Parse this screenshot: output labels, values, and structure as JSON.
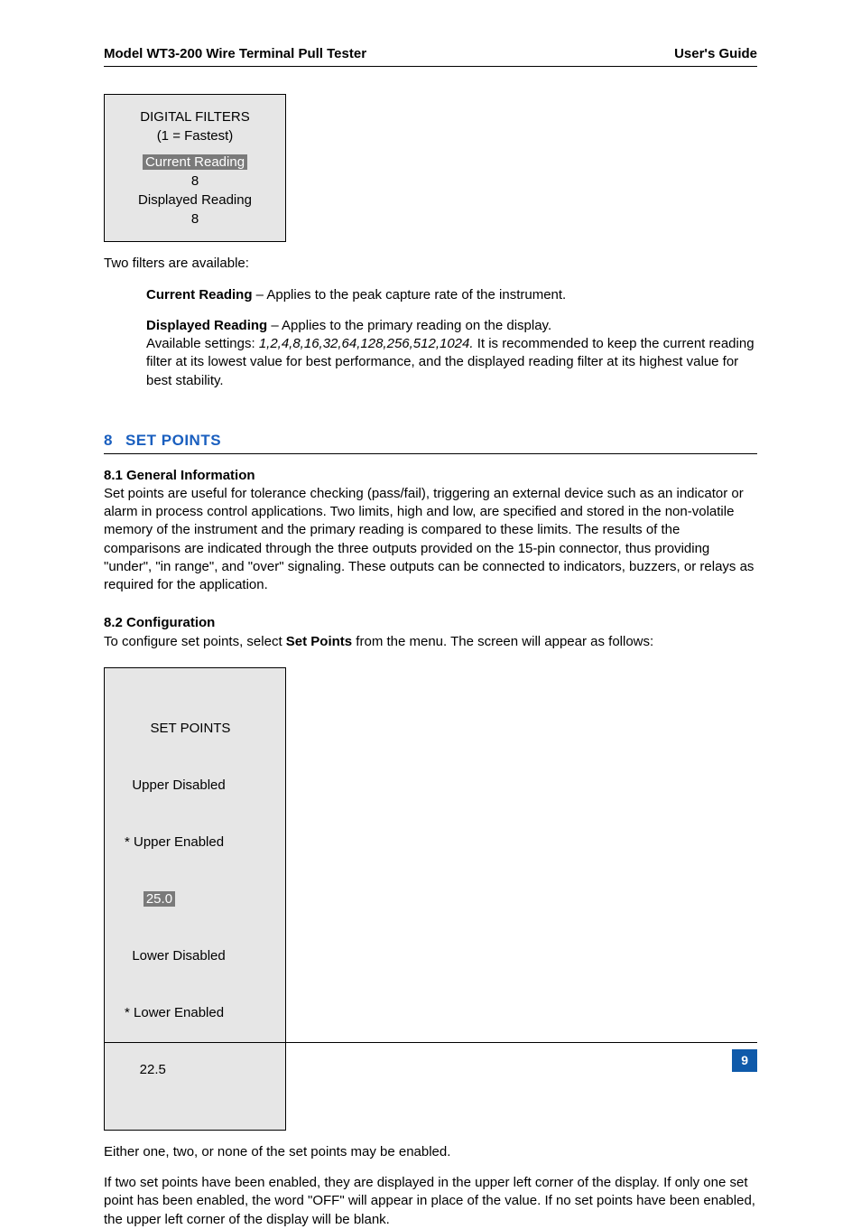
{
  "header": {
    "left": "Model WT3-200 Wire Terminal Pull Tester",
    "right": "User's Guide"
  },
  "lcd1": {
    "title": "DIGITAL FILTERS",
    "subtitle": "(1 = Fastest)",
    "row1_label": "Current Reading",
    "row1_value": "8",
    "row2_label": "Displayed Reading",
    "row2_value": "8"
  },
  "body": {
    "filters_intro": "Two filters are available:",
    "cr_label": "Current Reading",
    "cr_desc": " – Applies to the peak capture rate of the instrument.",
    "dr_label": "Displayed Reading",
    "dr_desc": " – Applies to the primary reading on the display.",
    "dr_settings_pre": "Available settings: ",
    "dr_settings_list": "1,2,4,8,16,32,64,128,256,512,1024.",
    "dr_settings_post": " It is recommended to keep the current reading filter at its lowest value for best performance, and the displayed reading filter at its highest value for best stability."
  },
  "section8": {
    "num": "8",
    "title": "SET POINTS",
    "sub81_heading": "8.1 General Information",
    "sub81_body": "Set points are useful for tolerance checking (pass/fail), triggering an external device such as an indicator or alarm in process control applications. Two limits, high and low, are specified and stored in the non-volatile memory of the instrument and the primary reading is compared to these limits. The results of the comparisons are indicated through the three outputs provided on the 15-pin connector, thus providing \"under\", \"in range\", and \"over\" signaling. These outputs can be connected to indicators, buzzers, or relays as required for the application.",
    "sub82_heading": "8.2 Configuration",
    "sub82_body_pre": "To configure set points, select ",
    "sub82_body_bold": "Set Points",
    "sub82_body_post": " from the menu. The screen will appear as follows:"
  },
  "lcd2": {
    "title": "SET POINTS",
    "row1": "  Upper Disabled",
    "row2": "* Upper Enabled",
    "row3_value": "25.0",
    "row4": "  Lower Disabled",
    "row5": "* Lower Enabled",
    "row6": "    22.5"
  },
  "after_lcd2": {
    "p1": "Either one, two, or none of the set points may be enabled.",
    "p2": "If two set points have been enabled, they are displayed in the upper left corner of the display. If only one set point has been enabled, the word \"OFF\" will appear in place of the value. If no set points have been enabled, the upper left corner of the display will be blank."
  },
  "page_number": "9"
}
